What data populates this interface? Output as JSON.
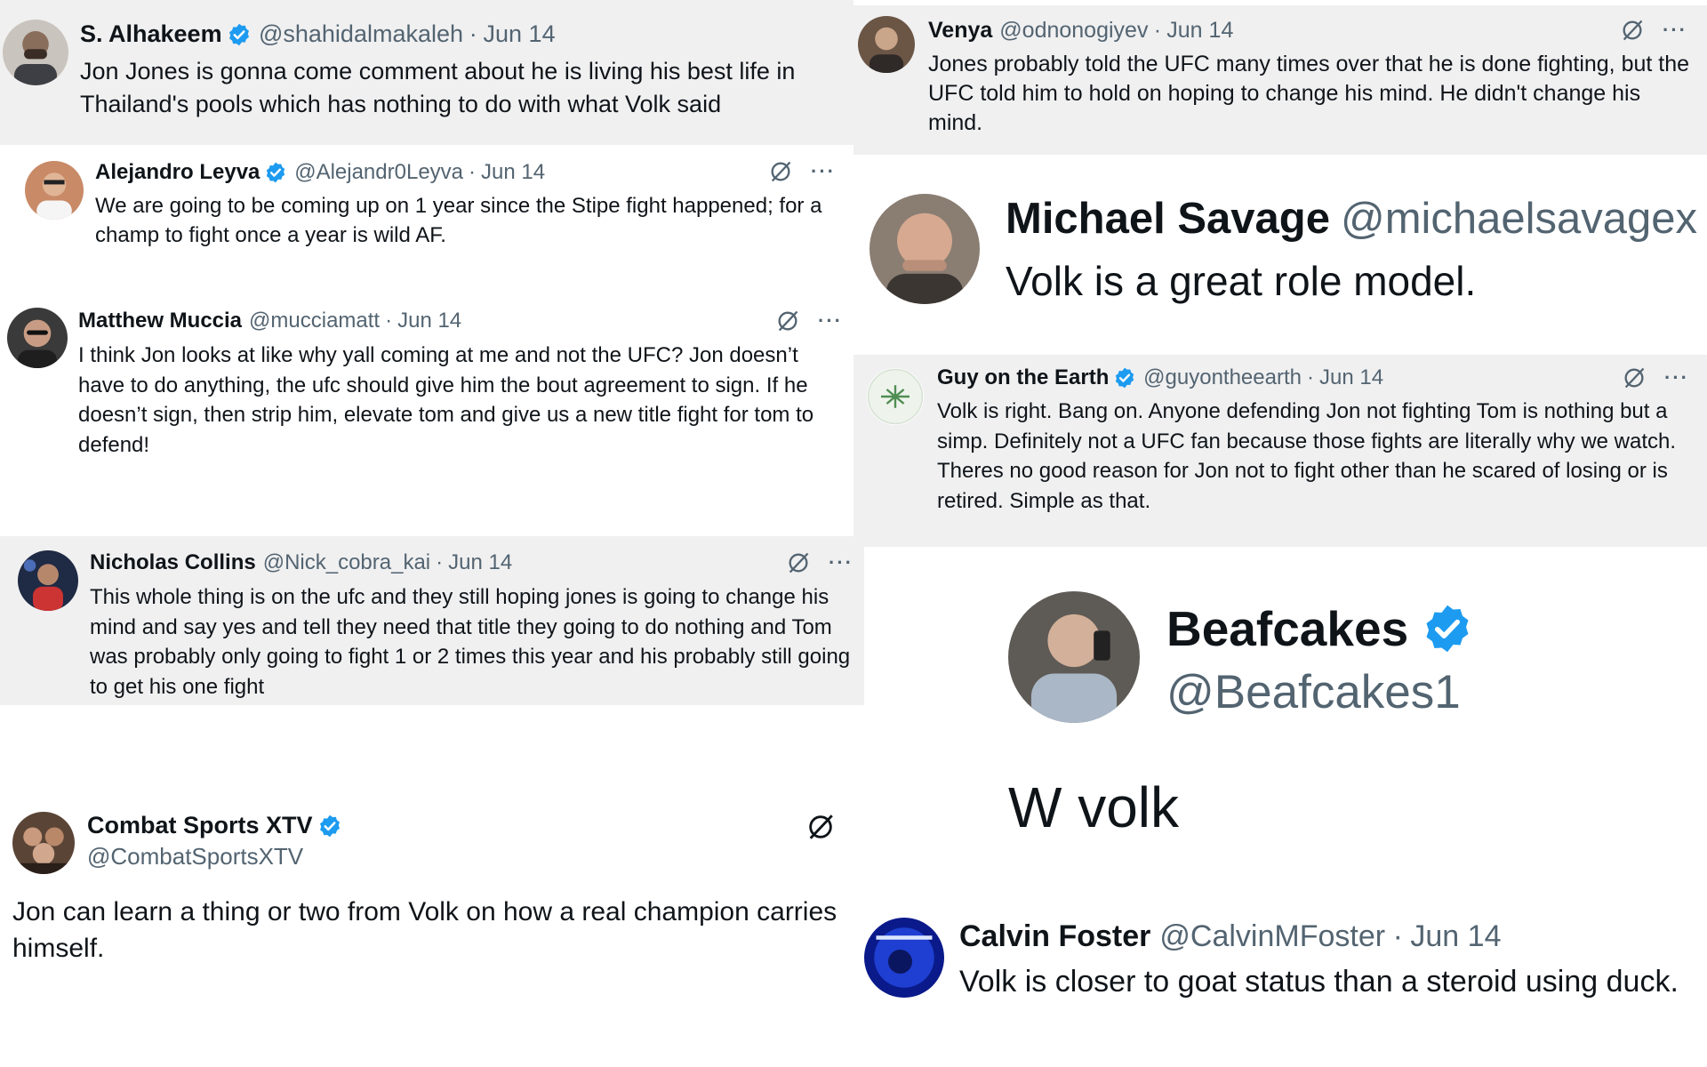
{
  "colors": {
    "verified": "#1d9bf0",
    "card_gray": "#f0f0f1",
    "text": "#0f1419",
    "muted": "#536471"
  },
  "icons": {
    "verified": "verified-badge-icon",
    "grok": "grok-slash-icon",
    "more": "more-dots-icon"
  },
  "posts": [
    {
      "name": "S. Alhakeem",
      "handle": "@shahidalmakaleh",
      "date": "Jun 14",
      "verified": true,
      "text": "Jon Jones is gonna come comment about he is living his best life in Thailand's pools which has nothing to do with what Volk said"
    },
    {
      "name": "Venya",
      "handle": "@odnonogiyev",
      "date": "Jun 14",
      "verified": false,
      "text": "Jones probably told the UFC many times over that he is done fighting, but the UFC told him to hold on hoping to change his mind. He didn't change his mind."
    },
    {
      "name": "Alejandro Leyva",
      "handle": "@Alejandr0Leyva",
      "date": "Jun 14",
      "verified": true,
      "text": "We are going to be coming up on 1 year since the Stipe fight happened; for a champ to fight once a year is wild AF."
    },
    {
      "name": "Michael Savage",
      "handle": "@michaelsavagex",
      "date": "",
      "verified": false,
      "text": "Volk is a great role model."
    },
    {
      "name": "Matthew Muccia",
      "handle": "@mucciamatt",
      "date": "Jun 14",
      "verified": false,
      "text": "I think Jon looks at like why yall coming at me and not the UFC? Jon doesn’t have to do anything, the ufc should give him the bout agreement to sign. If he doesn’t sign, then strip him, elevate tom and give us a new title fight for tom to defend!"
    },
    {
      "name": "Guy on the Earth",
      "handle": "@guyontheearth",
      "date": "Jun 14",
      "verified": true,
      "text": "Volk is right. Bang on. Anyone defending Jon not fighting Tom is nothing but a simp. Definitely not a UFC fan because those fights are literally why we watch.\nTheres no good reason for Jon not to fight other than he scared of losing or is retired. Simple as that."
    },
    {
      "name": "Nicholas Collins",
      "handle": "@Nick_cobra_kai",
      "date": "Jun 14",
      "verified": false,
      "text": "This whole thing is on the ufc and they still hoping jones is going to change his mind and say yes and tell they need that title they going to do nothing and Tom was probably only going to fight 1 or 2 times this year and his probably still going to get his one fight"
    },
    {
      "name": "Beafcakes",
      "handle": "@Beafcakes1",
      "date": "",
      "verified": true,
      "text": "W volk"
    },
    {
      "name": "Combat Sports XTV",
      "handle": "@CombatSportsXTV",
      "date": "",
      "verified": true,
      "text": "Jon can learn a thing or two from Volk on how a real champion carries himself."
    },
    {
      "name": "Calvin Foster",
      "handle": "@CalvinMFoster",
      "date": "Jun 14",
      "verified": false,
      "text": "Volk is closer to goat status than a steroid using duck."
    }
  ]
}
